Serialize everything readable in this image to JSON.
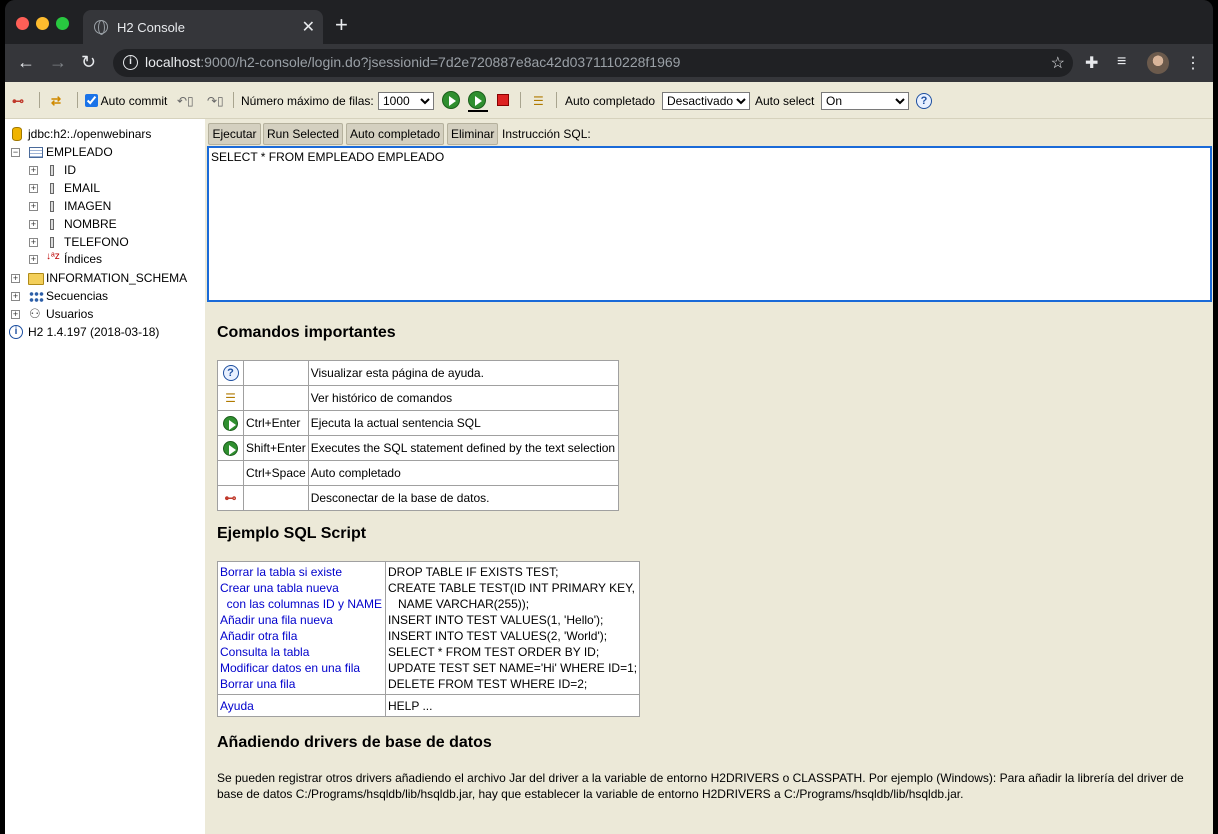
{
  "browser": {
    "tab_title": "H2 Console",
    "url_host": "localhost",
    "url_rest": ":9000/h2-console/login.do?jsessionid=7d2e720887e8ac42d0371110228f1969"
  },
  "toolbar": {
    "auto_commit_label": "Auto commit",
    "max_rows_label": "Número máximo de filas:",
    "max_rows_value": "1000",
    "autocomplete_label": "Auto completado",
    "autocomplete_value": "Desactivado",
    "autoselect_label": "Auto select",
    "autoselect_value": "On"
  },
  "tree": {
    "connection": "jdbc:h2:./openwebinars",
    "table": "EMPLEADO",
    "columns": [
      "ID",
      "EMAIL",
      "IMAGEN",
      "NOMBRE",
      "TELEFONO"
    ],
    "indexes": "Índices",
    "schema": "INFORMATION_SCHEMA",
    "sequences": "Secuencias",
    "users": "Usuarios",
    "version": "H2 1.4.197 (2018-03-18)"
  },
  "query": {
    "run": "Ejecutar",
    "run_selected": "Run Selected",
    "autocomplete": "Auto completado",
    "clear": "Eliminar",
    "label": "Instrucción SQL:",
    "sql": "SELECT * FROM EMPLEADO EMPLEADO"
  },
  "help": {
    "commands_title": "Comandos importantes",
    "commands": [
      {
        "key": "",
        "desc": "Visualizar esta página de ayuda."
      },
      {
        "key": "",
        "desc": "Ver histórico de comandos"
      },
      {
        "key": "Ctrl+Enter",
        "desc": "Ejecuta la actual sentencia SQL"
      },
      {
        "key": "Shift+Enter",
        "desc": "Executes the SQL statement defined by the text selection"
      },
      {
        "key": "Ctrl+Space",
        "desc": "Auto completado"
      },
      {
        "key": "",
        "desc": "Desconectar de la base de datos."
      }
    ],
    "script_title": "Ejemplo SQL Script",
    "script_links": [
      "Borrar la tabla si existe",
      "Crear una tabla nueva",
      "  con las columnas ID y NAME",
      "Añadir una fila nueva",
      "Añadir otra fila",
      "Consulta la tabla",
      "Modificar datos en una fila",
      "Borrar una fila"
    ],
    "script_sql": [
      "DROP TABLE IF EXISTS TEST;",
      "CREATE TABLE TEST(ID INT PRIMARY KEY,",
      "   NAME VARCHAR(255));",
      "INSERT INTO TEST VALUES(1, 'Hello');",
      "INSERT INTO TEST VALUES(2, 'World');",
      "SELECT * FROM TEST ORDER BY ID;",
      "UPDATE TEST SET NAME='Hi' WHERE ID=1;",
      "DELETE FROM TEST WHERE ID=2;"
    ],
    "help_link": "Ayuda",
    "help_sql": "HELP ...",
    "drivers_title": "Añadiendo drivers de base de datos",
    "drivers_text": "Se pueden registrar otros drivers añadiendo el archivo Jar del driver a la variable de entorno H2DRIVERS o CLASSPATH. Por ejemplo (Windows): Para añadir la librería del driver de base de datos C:/Programs/hsqldb/lib/hsqldb.jar, hay que establecer la variable de entorno H2DRIVERS a C:/Programs/hsqldb/lib/hsqldb.jar."
  }
}
